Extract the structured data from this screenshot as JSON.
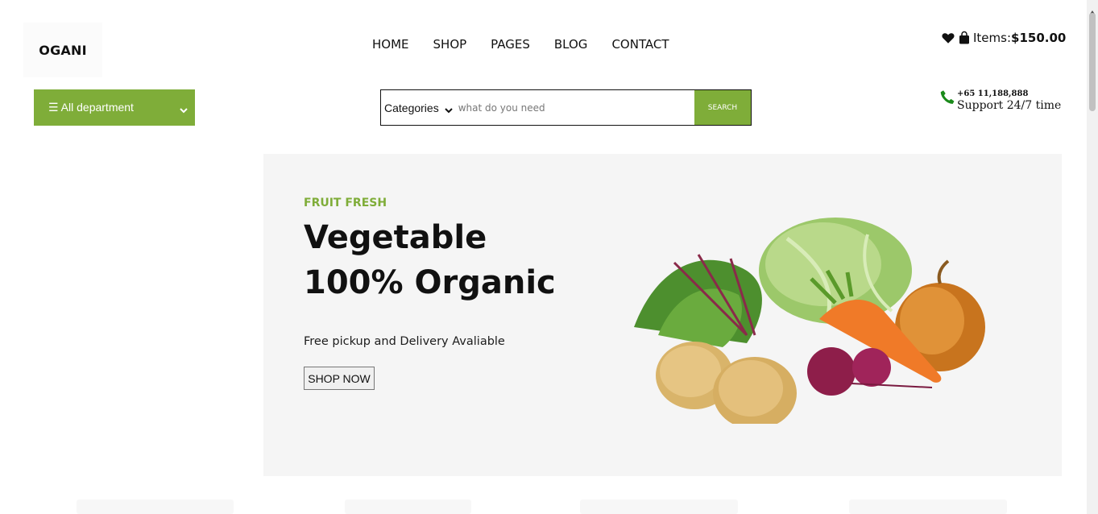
{
  "header": {
    "logo": "OGANI",
    "nav": [
      {
        "label": "HOME"
      },
      {
        "label": "SHOP"
      },
      {
        "label": "PAGES"
      },
      {
        "label": "BLOG"
      },
      {
        "label": "CONTACT"
      }
    ],
    "cart": {
      "items_label": "Items:",
      "total": "$150.00",
      "icons": [
        "heart-icon",
        "shopping-bag-icon"
      ]
    }
  },
  "departments": {
    "label": "☰ All department",
    "icon": "chevron-down-icon"
  },
  "search": {
    "category_label": "Categories",
    "placeholder": "what do you need",
    "value": "",
    "button_label": "SEARCH"
  },
  "support": {
    "phone": "+65 11,188,888",
    "text": "Support 24/7 time",
    "icon": "phone-icon"
  },
  "hero": {
    "tag": "FRUIT FRESH",
    "title_line1": "Vegetable",
    "title_line2": "100% Organic",
    "subtitle": "Free pickup and Delivery Avaliable",
    "button_label": "SHOP NOW"
  },
  "colors": {
    "accent": "#7fad39",
    "hero_bg": "#f5f5f5",
    "text": "#111111"
  }
}
